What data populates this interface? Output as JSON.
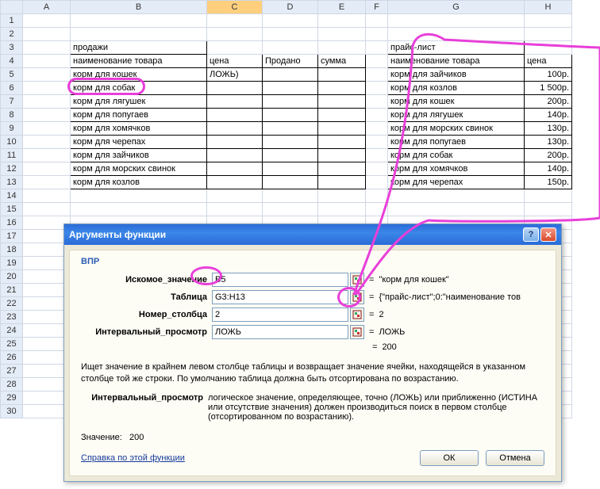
{
  "columns": [
    "A",
    "B",
    "C",
    "D",
    "E",
    "F",
    "G",
    "H"
  ],
  "rows": 30,
  "selectedCol": "C",
  "sheet": {
    "B3": "продажи",
    "B4": "наименование товара",
    "C4": "цена",
    "D4": "Продано",
    "E4": "сумма",
    "B5": "корм для кошек",
    "C5": "ЛОЖЬ)",
    "B6": "корм для собак",
    "B7": "корм для лягушек",
    "B8": "корм для попугаев",
    "B9": "корм для хомячков",
    "B10": "корм для черепах",
    "B11": "корм для зайчиков",
    "B12": "корм для морских свинок",
    "B13": "корм для козлов",
    "G3": "прайс-лист",
    "G4": "наименование товара",
    "H4": "цена",
    "G5": "корм для зайчиков",
    "H5": "100р.",
    "G6": "корм для козлов",
    "H6": "1 500р.",
    "G7": "корм для кошек",
    "H7": "200р.",
    "G8": "корм для лягушек",
    "H8": "140р.",
    "G9": "корм для морских свинок",
    "H9": "130р.",
    "G10": "корм для попугаев",
    "H10": "130р.",
    "G11": "корм для собак",
    "H11": "200р.",
    "G12": "корм для хомячков",
    "H12": "140р.",
    "G13": "корм для черепах",
    "H13": "150р."
  },
  "bordered": [
    "B3",
    "B4",
    "C4",
    "D4",
    "E4",
    "B5",
    "C5",
    "D5",
    "E5",
    "B6",
    "C6",
    "D6",
    "E6",
    "B7",
    "C7",
    "D7",
    "E7",
    "B8",
    "C8",
    "D8",
    "E8",
    "B9",
    "C9",
    "D9",
    "E9",
    "B10",
    "C10",
    "D10",
    "E10",
    "B11",
    "C11",
    "D11",
    "E11",
    "B12",
    "C12",
    "D12",
    "E12",
    "B13",
    "C13",
    "D13",
    "E13",
    "G3",
    "G4",
    "H4",
    "G5",
    "H5",
    "G6",
    "H6",
    "G7",
    "H7",
    "G8",
    "H8",
    "G9",
    "H9",
    "G10",
    "H10",
    "G11",
    "H11",
    "G12",
    "H12",
    "G13",
    "H13"
  ],
  "rightAlign": [
    "H5",
    "H6",
    "H7",
    "H8",
    "H9",
    "H10",
    "H11",
    "H12",
    "H13"
  ],
  "dialog": {
    "title": "Аргументы функции",
    "fn": "ВПР",
    "args": {
      "lookup_label": "Искомое_значение",
      "lookup_val": "B5",
      "lookup_res": "\"корм для кошек\"",
      "table_label": "Таблица",
      "table_val": "G3:H13",
      "table_res": "{\"прайс-лист\";0:\"наименование тов",
      "col_label": "Номер_столбца",
      "col_val": "2",
      "col_res": "2",
      "range_label": "Интервальный_просмотр",
      "range_val": "ЛОЖЬ",
      "range_res": "ЛОЖЬ",
      "final_res": "200"
    },
    "desc": "Ищет значение в крайнем левом столбце таблицы и возвращает значение ячейки, находящейся в указанном столбце той же строки. По умолчанию таблица должна быть отсортирована по возрастанию.",
    "desc2_label": "Интервальный_просмотр",
    "desc2_text": "логическое значение, определяющее, точно (ЛОЖЬ) или приближенно (ИСТИНА или отсутствие значения) должен производиться поиск в первом столбце (отсортированном по возрастанию).",
    "value_label": "Значение:",
    "value": "200",
    "help": "Справка по этой функции",
    "ok": "ОК",
    "cancel": "Отмена",
    "eq": "="
  }
}
